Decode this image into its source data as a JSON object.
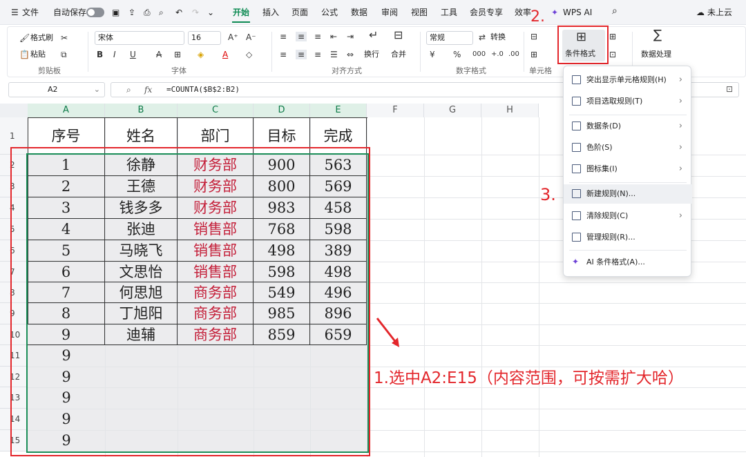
{
  "menubar": {
    "file": "文件",
    "autosave": "自动保存",
    "tabs": [
      "开始",
      "插入",
      "页面",
      "公式",
      "数据",
      "审阅",
      "视图",
      "工具",
      "会员专享",
      "效率"
    ],
    "wps_ai": "WPS AI",
    "cloud": "未上云"
  },
  "ribbon": {
    "format_painter": "格式刷",
    "paste": "粘贴",
    "clipboard_group": "剪贴板",
    "font_name": "宋体",
    "font_size": "16",
    "font_group": "字体",
    "wrap": "换行",
    "merge": "合并",
    "align_group": "对齐方式",
    "number_format": "常规",
    "convert": "转换",
    "number_group": "数字格式",
    "cell_group": "单元格",
    "cond_format": "条件格式",
    "data_process": "数据处理"
  },
  "formula_bar": {
    "name_box": "A2",
    "fx": "fx",
    "formula": "=COUNTA($B$2:B2)"
  },
  "columns": [
    "A",
    "B",
    "C",
    "D",
    "E",
    "F",
    "G",
    "H"
  ],
  "rows": [
    "1",
    "2",
    "3",
    "4",
    "5",
    "6",
    "7",
    "8",
    "9",
    "10",
    "11",
    "12",
    "13",
    "14",
    "15"
  ],
  "table": {
    "headers": [
      "序号",
      "姓名",
      "部门",
      "目标",
      "完成"
    ],
    "rows": [
      [
        "1",
        "徐静",
        "财务部",
        "900",
        "563"
      ],
      [
        "2",
        "王德",
        "财务部",
        "800",
        "569"
      ],
      [
        "3",
        "钱多多",
        "财务部",
        "983",
        "458"
      ],
      [
        "4",
        "张迪",
        "销售部",
        "768",
        "598"
      ],
      [
        "5",
        "马晓飞",
        "销售部",
        "498",
        "389"
      ],
      [
        "6",
        "文思怡",
        "销售部",
        "598",
        "498"
      ],
      [
        "7",
        "何思旭",
        "商务部",
        "549",
        "496"
      ],
      [
        "8",
        "丁旭阳",
        "商务部",
        "985",
        "896"
      ],
      [
        "9",
        "迪辅",
        "商务部",
        "859",
        "659"
      ]
    ],
    "extra_seq": [
      "9",
      "9",
      "9",
      "9",
      "9"
    ]
  },
  "dropdown": {
    "items": [
      {
        "label": "突出显示单元格规则(H)",
        "submenu": true
      },
      {
        "label": "项目选取规则(T)",
        "submenu": true
      },
      {
        "label": "数据条(D)",
        "submenu": true
      },
      {
        "label": "色阶(S)",
        "submenu": true
      },
      {
        "label": "图标集(I)",
        "submenu": true
      },
      {
        "label": "新建规则(N)...",
        "submenu": false
      },
      {
        "label": "清除规则(C)",
        "submenu": true
      },
      {
        "label": "管理规则(R)...",
        "submenu": false
      },
      {
        "label": "AI 条件格式(A)...",
        "submenu": false
      }
    ]
  },
  "annotations": {
    "step1": "1.选中A2:E15（内容范围，可按需扩大哈）",
    "step2": "2.",
    "step3": "3."
  },
  "colors": {
    "accent": "#0c8a52",
    "annotation": "#e3262b",
    "dept_text": "#c4203a"
  }
}
